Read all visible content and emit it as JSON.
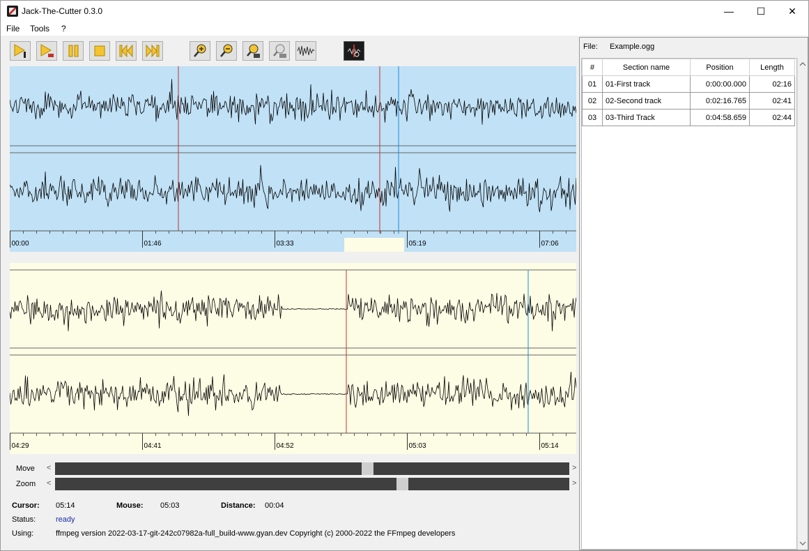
{
  "window": {
    "title": "Jack-The-Cutter 0.3.0",
    "minimize": "—",
    "maximize": "☐",
    "close": "✕"
  },
  "menu": [
    "File",
    "Tools",
    "?"
  ],
  "toolbar": [
    {
      "name": "play-from-start-icon"
    },
    {
      "name": "play-section-icon"
    },
    {
      "name": "pause-icon"
    },
    {
      "name": "stop-icon"
    },
    {
      "name": "skip-back-icon"
    },
    {
      "name": "skip-forward-icon"
    },
    {
      "name": "zoom-in-icon"
    },
    {
      "name": "zoom-out-icon"
    },
    {
      "name": "zoom-to-section-icon"
    },
    {
      "name": "zoom-fit-icon"
    },
    {
      "name": "waveform-icon"
    },
    {
      "name": "cut-icon"
    }
  ],
  "overview": {
    "ticks": [
      "00:00",
      "01:46",
      "03:33",
      "05:19",
      "07:06"
    ]
  },
  "detail": {
    "ticks": [
      "04:29",
      "04:41",
      "04:52",
      "05:03",
      "05:14"
    ]
  },
  "sliders": {
    "move_label": "Move",
    "zoom_label": "Zoom",
    "left_arrow": "<",
    "right_arrow": ">",
    "move_position": 0.61,
    "zoom_position": 0.68
  },
  "info": {
    "cursor_label": "Cursor:",
    "cursor_value": "05:14",
    "mouse_label": "Mouse:",
    "mouse_value": "05:03",
    "distance_label": "Distance:",
    "distance_value": "00:04",
    "status_label": "Status:",
    "status_value": "ready",
    "using_label": "Using:",
    "using_value": "ffmpeg version 2022-03-17-git-242c07982a-full_build-www.gyan.dev Copyright (c) 2000-2022 the FFmpeg developers"
  },
  "file": {
    "label": "File:",
    "name": "Example.ogg"
  },
  "sections": {
    "headers": [
      "#",
      "Section name",
      "Position",
      "Length"
    ],
    "rows": [
      {
        "num": "01",
        "name": "01-First track",
        "position": "0:00:00.000",
        "length": "02:16"
      },
      {
        "num": "02",
        "name": "02-Second track",
        "position": "0:02:16.765",
        "length": "02:41"
      },
      {
        "num": "03",
        "name": "03-Third Track",
        "position": "0:04:58.659",
        "length": "02:44"
      }
    ]
  },
  "colors": {
    "overview_bg": "#c0e1f6",
    "detail_bg": "#fdfce4",
    "section_marker": "#c2332b",
    "cursor_marker": "#1f8ad8",
    "status_value": "#1c2ea8"
  }
}
